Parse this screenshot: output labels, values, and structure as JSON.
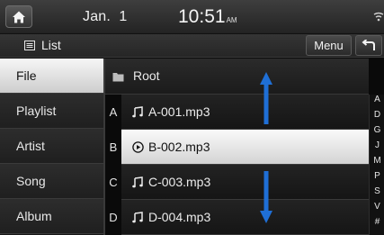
{
  "status_bar": {
    "date": "Jan.  1",
    "time": "10:51",
    "ampm": "AM"
  },
  "title_bar": {
    "title": "List",
    "menu_label": "Menu"
  },
  "sidebar": {
    "items": [
      {
        "label": "File",
        "selected": true
      },
      {
        "label": "Playlist",
        "selected": false
      },
      {
        "label": "Artist",
        "selected": false
      },
      {
        "label": "Song",
        "selected": false
      },
      {
        "label": "Album",
        "selected": false
      }
    ]
  },
  "browser": {
    "folder": "Root",
    "tracks": [
      {
        "letter": "A",
        "name": "A-001.mp3",
        "icon": "music-note-icon",
        "selected": false
      },
      {
        "letter": "B",
        "name": "B-002.mp3",
        "icon": "play-circle-icon",
        "selected": true
      },
      {
        "letter": "C",
        "name": "C-003.mp3",
        "icon": "music-note-icon",
        "selected": false
      },
      {
        "letter": "D",
        "name": "D-004.mp3",
        "icon": "music-note-icon",
        "selected": false
      }
    ]
  },
  "alpha_index": [
    "A",
    "D",
    "G",
    "J",
    "M",
    "P",
    "S",
    "V",
    "#"
  ],
  "colors": {
    "scroll_arrow": "#1f6fd6",
    "selected_row": "#e6e6e6"
  }
}
